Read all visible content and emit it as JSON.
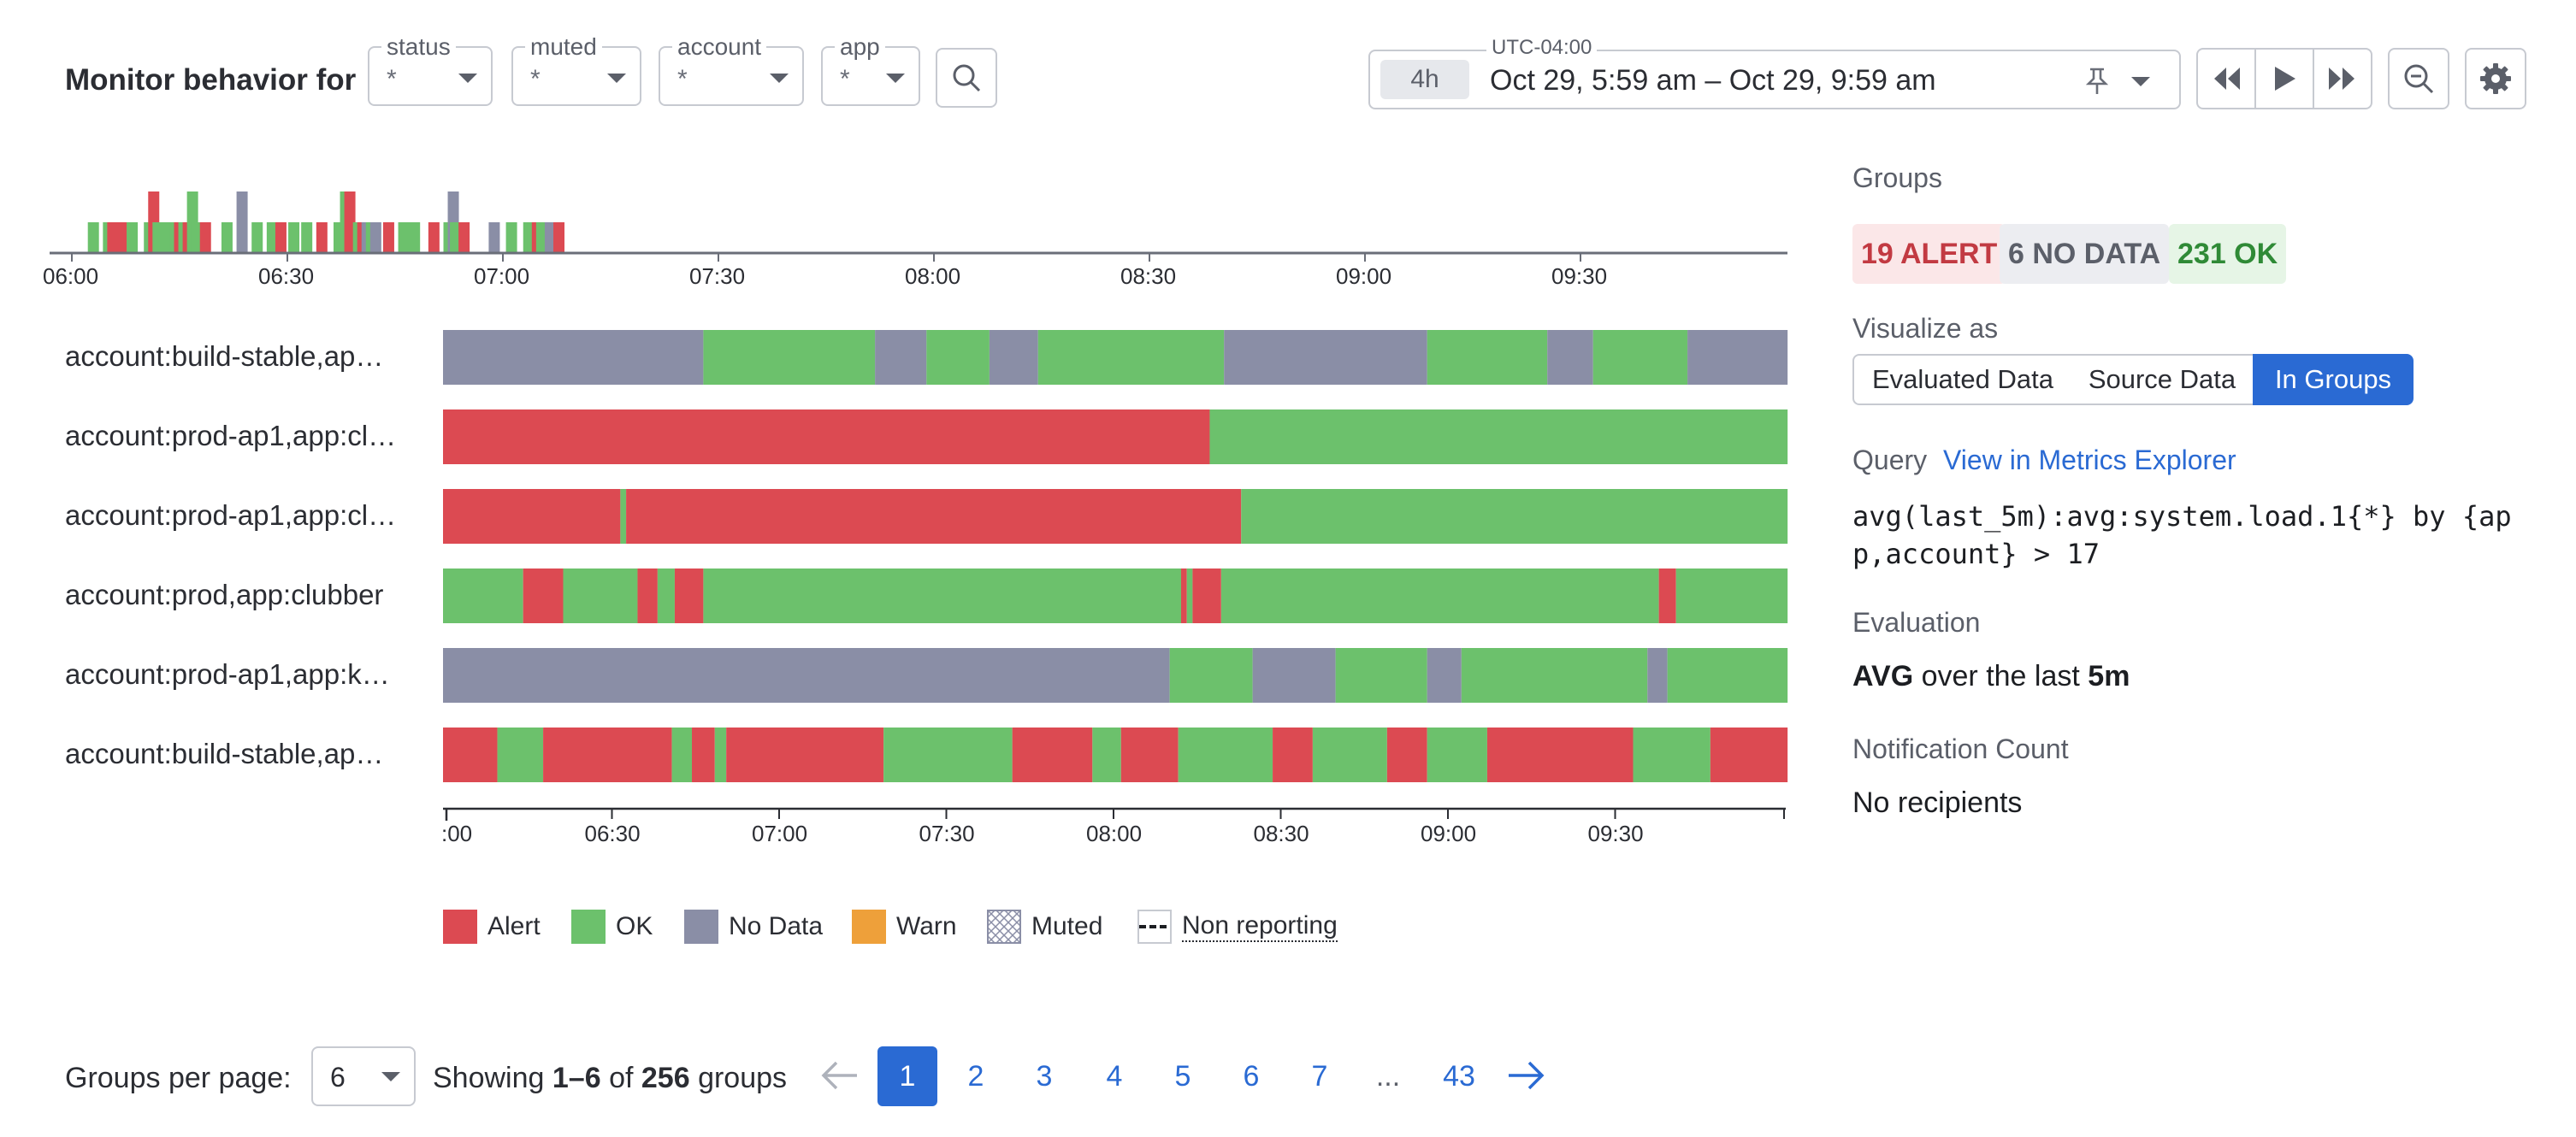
{
  "toolbar": {
    "title": "Monitor behavior for",
    "filters": [
      {
        "legend": "status",
        "value": "*"
      },
      {
        "legend": "muted",
        "value": "*"
      },
      {
        "legend": "account",
        "value": "*"
      },
      {
        "legend": "app",
        "value": "*"
      }
    ],
    "timezone": "UTC-04:00",
    "range_chip": "4h",
    "range_text": "Oct 29, 5:59 am – Oct 29, 9:59 am"
  },
  "colors": {
    "alert": "#dc4a52",
    "ok": "#6cc16c",
    "nodata": "#8a8ea6",
    "warn": "#eea03a",
    "accent": "#2a6ad3"
  },
  "overview": {
    "ticks": [
      "06:00",
      "06:30",
      "07:00",
      "07:30",
      "08:00",
      "08:30",
      "09:00",
      "09:30"
    ],
    "events": [
      {
        "t": 0.1,
        "c": "ok"
      },
      {
        "t": 0.17,
        "c": "ok"
      },
      {
        "t": 0.19,
        "c": "alert"
      },
      {
        "t": 0.23,
        "c": "alert"
      },
      {
        "t": 0.28,
        "c": "ok"
      },
      {
        "t": 0.36,
        "c": "ok"
      },
      {
        "t": 0.38,
        "c": "alert",
        "h": 1.0
      },
      {
        "t": 0.4,
        "c": "ok"
      },
      {
        "t": 0.44,
        "c": "ok"
      },
      {
        "t": 0.46,
        "c": "ok"
      },
      {
        "t": 0.48,
        "c": "ok"
      },
      {
        "t": 0.5,
        "c": "alert"
      },
      {
        "t": 0.52,
        "c": "ok"
      },
      {
        "t": 0.54,
        "c": "alert"
      },
      {
        "t": 0.56,
        "c": "ok",
        "h": 1.0
      },
      {
        "t": 0.58,
        "c": "ok"
      },
      {
        "t": 0.62,
        "c": "alert"
      },
      {
        "t": 0.72,
        "c": "ok"
      },
      {
        "t": 0.79,
        "c": "nodata",
        "h": 1.0
      },
      {
        "t": 0.86,
        "c": "ok"
      },
      {
        "t": 0.93,
        "c": "ok"
      },
      {
        "t": 0.97,
        "c": "alert"
      },
      {
        "t": 1.03,
        "c": "ok"
      },
      {
        "t": 1.09,
        "c": "ok"
      },
      {
        "t": 1.16,
        "c": "alert"
      },
      {
        "t": 1.24,
        "c": "ok"
      },
      {
        "t": 1.27,
        "c": "ok",
        "h": 1.0
      },
      {
        "t": 1.29,
        "c": "alert",
        "h": 1.0
      },
      {
        "t": 1.31,
        "c": "alert"
      },
      {
        "t": 1.33,
        "c": "ok"
      },
      {
        "t": 1.35,
        "c": "alert"
      },
      {
        "t": 1.37,
        "c": "nodata"
      },
      {
        "t": 1.39,
        "c": "ok"
      },
      {
        "t": 1.41,
        "c": "nodata"
      },
      {
        "t": 1.47,
        "c": "alert"
      },
      {
        "t": 1.54,
        "c": "ok"
      },
      {
        "t": 1.59,
        "c": "ok"
      },
      {
        "t": 1.68,
        "c": "alert"
      },
      {
        "t": 1.75,
        "c": "ok"
      },
      {
        "t": 1.77,
        "c": "nodata",
        "h": 1.0
      },
      {
        "t": 1.78,
        "c": "ok"
      },
      {
        "t": 1.82,
        "c": "alert"
      },
      {
        "t": 1.96,
        "c": "nodata"
      },
      {
        "t": 2.04,
        "c": "ok"
      },
      {
        "t": 2.12,
        "c": "ok"
      },
      {
        "t": 2.14,
        "c": "ok"
      },
      {
        "t": 2.16,
        "c": "alert"
      },
      {
        "t": 2.18,
        "c": "ok"
      },
      {
        "t": 2.2,
        "c": "ok"
      },
      {
        "t": 2.22,
        "c": "nodata"
      },
      {
        "t": 2.26,
        "c": "alert"
      }
    ]
  },
  "groups": [
    {
      "label": "account:build-stable,ap…",
      "segments": [
        {
          "s": 0.0,
          "e": 0.91,
          "c": "nodata"
        },
        {
          "s": 0.91,
          "e": 1.51,
          "c": "ok"
        },
        {
          "s": 1.51,
          "e": 1.69,
          "c": "nodata"
        },
        {
          "s": 1.69,
          "e": 1.91,
          "c": "ok"
        },
        {
          "s": 1.91,
          "e": 2.08,
          "c": "nodata"
        },
        {
          "s": 2.08,
          "e": 2.73,
          "c": "ok"
        },
        {
          "s": 2.73,
          "e": 3.44,
          "c": "nodata"
        },
        {
          "s": 3.44,
          "e": 3.86,
          "c": "ok"
        },
        {
          "s": 3.86,
          "e": 4.02,
          "c": "nodata"
        },
        {
          "s": 4.02,
          "e": 4.35,
          "c": "ok"
        },
        {
          "s": 4.35,
          "e": 4.7,
          "c": "nodata"
        }
      ]
    },
    {
      "label": "account:prod-ap1,app:cl…",
      "segments": [
        {
          "s": 0.0,
          "e": 2.68,
          "c": "alert"
        },
        {
          "s": 2.68,
          "e": 4.7,
          "c": "ok"
        }
      ]
    },
    {
      "label": "account:prod-ap1,app:cl…",
      "segments": [
        {
          "s": 0.0,
          "e": 0.62,
          "c": "alert"
        },
        {
          "s": 0.62,
          "e": 0.64,
          "c": "ok"
        },
        {
          "s": 0.64,
          "e": 2.79,
          "c": "alert"
        },
        {
          "s": 2.79,
          "e": 4.7,
          "c": "ok"
        }
      ]
    },
    {
      "label": "account:prod,app:clubber",
      "segments": [
        {
          "s": 0.0,
          "e": 0.28,
          "c": "ok"
        },
        {
          "s": 0.28,
          "e": 0.42,
          "c": "alert"
        },
        {
          "s": 0.42,
          "e": 0.68,
          "c": "ok"
        },
        {
          "s": 0.68,
          "e": 0.75,
          "c": "alert"
        },
        {
          "s": 0.75,
          "e": 0.81,
          "c": "ok"
        },
        {
          "s": 0.81,
          "e": 0.91,
          "c": "alert"
        },
        {
          "s": 0.91,
          "e": 2.58,
          "c": "ok"
        },
        {
          "s": 2.58,
          "e": 2.6,
          "c": "alert"
        },
        {
          "s": 2.6,
          "e": 2.62,
          "c": "ok"
        },
        {
          "s": 2.62,
          "e": 2.72,
          "c": "alert"
        },
        {
          "s": 2.72,
          "e": 4.25,
          "c": "ok"
        },
        {
          "s": 4.25,
          "e": 4.31,
          "c": "alert"
        },
        {
          "s": 4.31,
          "e": 4.7,
          "c": "ok"
        }
      ]
    },
    {
      "label": "account:prod-ap1,app:k…",
      "segments": [
        {
          "s": 0.0,
          "e": 2.54,
          "c": "nodata"
        },
        {
          "s": 2.54,
          "e": 2.83,
          "c": "ok"
        },
        {
          "s": 2.83,
          "e": 3.12,
          "c": "nodata"
        },
        {
          "s": 3.12,
          "e": 3.44,
          "c": "ok"
        },
        {
          "s": 3.44,
          "e": 3.56,
          "c": "nodata"
        },
        {
          "s": 3.56,
          "e": 4.21,
          "c": "ok"
        },
        {
          "s": 4.21,
          "e": 4.28,
          "c": "nodata"
        },
        {
          "s": 4.28,
          "e": 4.7,
          "c": "ok"
        }
      ]
    },
    {
      "label": "account:build-stable,ap…",
      "segments": [
        {
          "s": 0.0,
          "e": 0.19,
          "c": "alert"
        },
        {
          "s": 0.19,
          "e": 0.35,
          "c": "ok"
        },
        {
          "s": 0.35,
          "e": 0.8,
          "c": "alert"
        },
        {
          "s": 0.8,
          "e": 0.87,
          "c": "ok"
        },
        {
          "s": 0.87,
          "e": 0.95,
          "c": "alert"
        },
        {
          "s": 0.95,
          "e": 0.99,
          "c": "ok"
        },
        {
          "s": 0.99,
          "e": 1.54,
          "c": "alert"
        },
        {
          "s": 1.54,
          "e": 1.99,
          "c": "ok"
        },
        {
          "s": 1.99,
          "e": 2.27,
          "c": "alert"
        },
        {
          "s": 2.27,
          "e": 2.37,
          "c": "ok"
        },
        {
          "s": 2.37,
          "e": 2.57,
          "c": "alert"
        },
        {
          "s": 2.57,
          "e": 2.9,
          "c": "ok"
        },
        {
          "s": 2.9,
          "e": 3.04,
          "c": "alert"
        },
        {
          "s": 3.04,
          "e": 3.3,
          "c": "ok"
        },
        {
          "s": 3.3,
          "e": 3.44,
          "c": "alert"
        },
        {
          "s": 3.44,
          "e": 3.65,
          "c": "ok"
        },
        {
          "s": 3.65,
          "e": 4.16,
          "c": "alert"
        },
        {
          "s": 4.16,
          "e": 4.43,
          "c": "ok"
        },
        {
          "s": 4.43,
          "e": 4.7,
          "c": "alert"
        }
      ]
    }
  ],
  "group_axis": {
    "first_tick": ":00",
    "ticks": [
      "06:30",
      "07:00",
      "07:30",
      "08:00",
      "08:30",
      "09:00",
      "09:30"
    ]
  },
  "legend": [
    "Alert",
    "OK",
    "No Data",
    "Warn",
    "Muted",
    "Non reporting"
  ],
  "panel": {
    "groups_label": "Groups",
    "badges": {
      "alert": "19 ALERT",
      "nodata": "6 NO DATA",
      "ok": "231 OK"
    },
    "visualize_label": "Visualize as",
    "visualize_options": [
      "Evaluated Data",
      "Source Data",
      "In Groups"
    ],
    "query_label": "Query",
    "query_link": "View in Metrics Explorer",
    "query_line1": "avg(last_5m):avg:system.load.1{*} by {ap",
    "query_line2": "p,account} > 17",
    "evaluation_label": "Evaluation",
    "evaluation_agg": "AVG",
    "evaluation_mid": "over the last",
    "evaluation_window": "5m",
    "notification_label": "Notification Count",
    "notification_value": "No recipients"
  },
  "pagination": {
    "per_page_label": "Groups per page:",
    "per_page_value": "6",
    "showing_prefix": "Showing",
    "showing_range": "1–6",
    "showing_of": "of",
    "showing_total": "256",
    "showing_suffix": "groups",
    "pages": [
      "1",
      "2",
      "3",
      "4",
      "5",
      "6",
      "7"
    ],
    "ellipsis": "...",
    "last_page": "43",
    "current": "1"
  }
}
